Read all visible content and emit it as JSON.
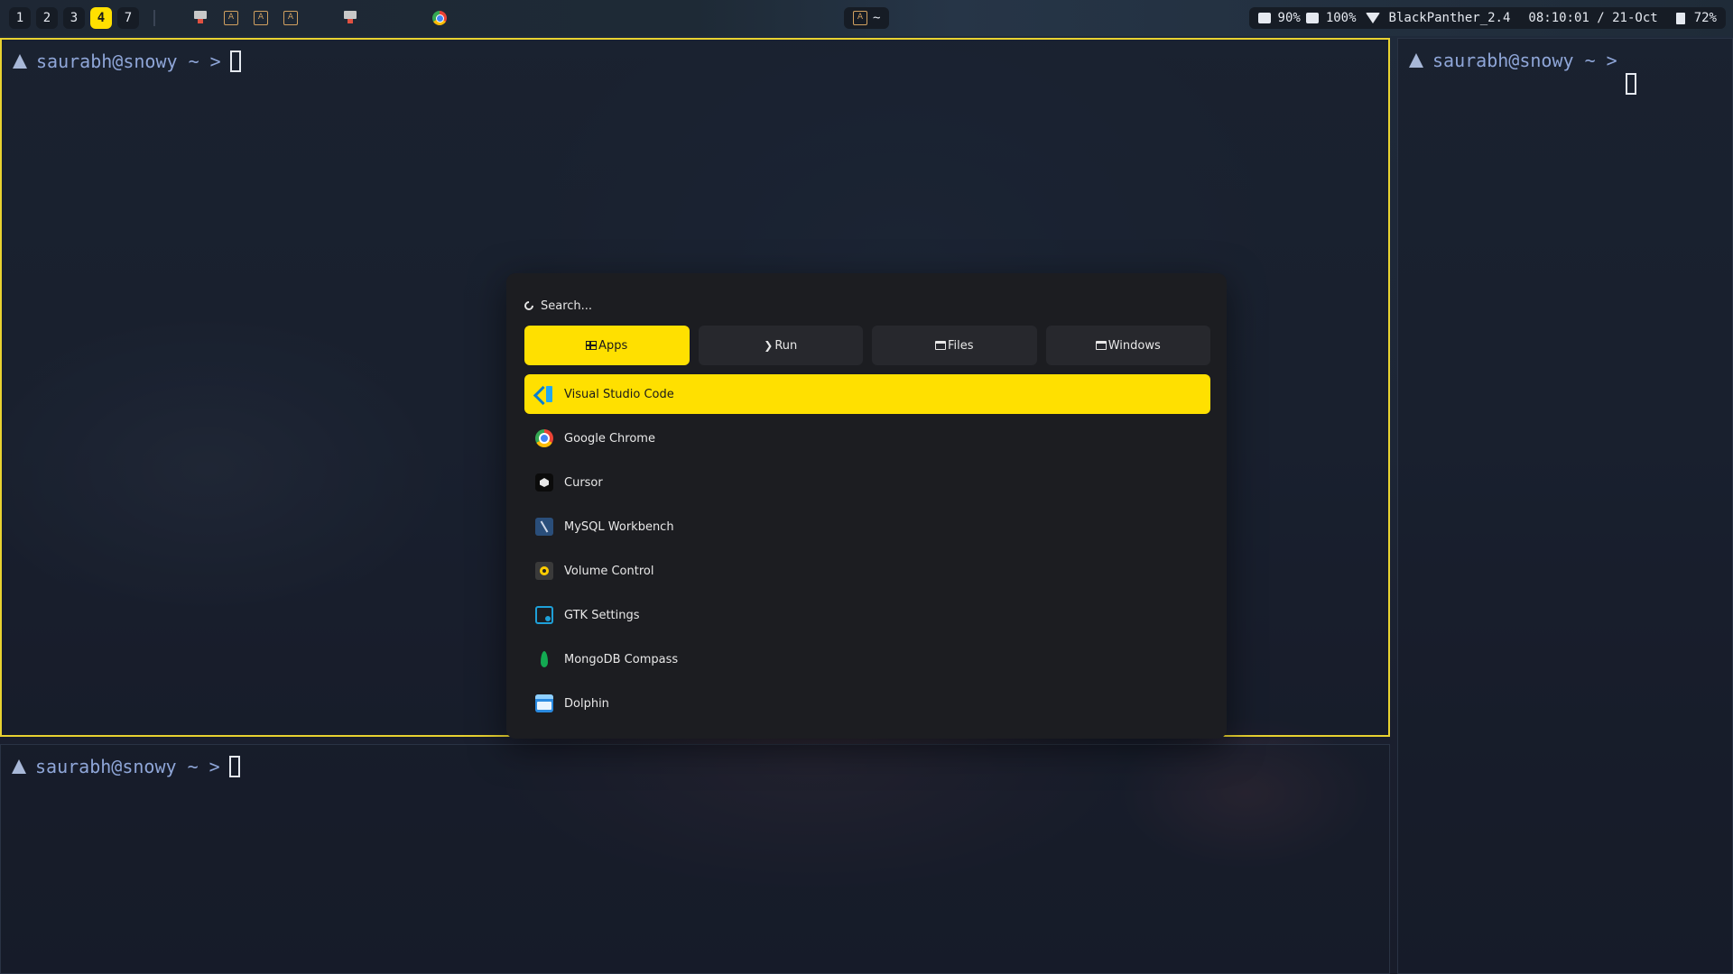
{
  "topbar": {
    "workspaces": [
      {
        "label": "1",
        "active": false
      },
      {
        "label": "2",
        "active": false
      },
      {
        "label": "3",
        "active": false
      },
      {
        "label": "4",
        "active": true
      },
      {
        "label": "7",
        "active": false
      }
    ],
    "terminal_icon_glyph": "A",
    "center_title": "~",
    "status": {
      "brightness": "90%",
      "volume": "100%",
      "wifi": "BlackPanther_2.4",
      "clock": "08:10:01 / 21-Oct",
      "battery": "72%"
    },
    "accent": "#ffe000"
  },
  "terminals": {
    "prompt": "saurabh@snowy ~ >"
  },
  "launcher": {
    "search": {
      "placeholder": "Search..."
    },
    "tabs": [
      {
        "label": "Apps",
        "icon": "grid-icon",
        "active": true
      },
      {
        "label": "Run",
        "icon": "chevron-right-icon",
        "active": false
      },
      {
        "label": "Files",
        "icon": "folder-icon",
        "active": false
      },
      {
        "label": "Windows",
        "icon": "window-icon",
        "active": false
      }
    ],
    "apps": [
      {
        "label": "Visual Studio Code",
        "icon": "vscode-icon",
        "selected": true
      },
      {
        "label": "Google Chrome",
        "icon": "chrome-icon",
        "selected": false
      },
      {
        "label": "Cursor",
        "icon": "cursor-icon",
        "selected": false
      },
      {
        "label": "MySQL Workbench",
        "icon": "mysql-workbench-icon",
        "selected": false
      },
      {
        "label": "Volume Control",
        "icon": "volume-control-icon",
        "selected": false
      },
      {
        "label": "GTK Settings",
        "icon": "gtk-settings-icon",
        "selected": false
      },
      {
        "label": "MongoDB Compass",
        "icon": "mongodb-compass-icon",
        "selected": false
      },
      {
        "label": "Dolphin",
        "icon": "dolphin-icon",
        "selected": false
      }
    ]
  }
}
